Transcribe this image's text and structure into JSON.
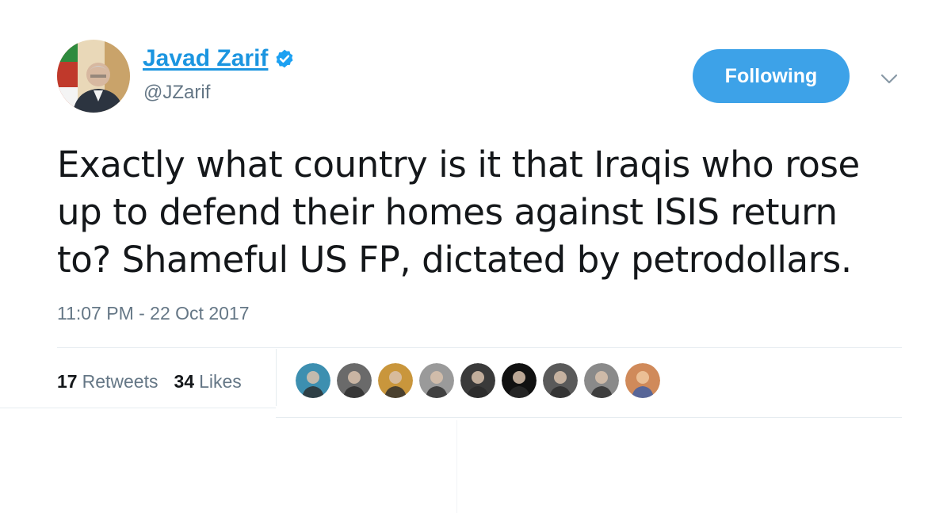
{
  "author": {
    "display_name": "Javad Zarif",
    "handle": "@JZarif",
    "verified": true,
    "avatar_icon": "profile-photo-icon"
  },
  "follow_button": {
    "label": "Following",
    "color": "#3da2e8"
  },
  "menu": {
    "icon": "chevron-down-icon"
  },
  "tweet": {
    "lines": [
      "Exactly what country is it that Iraqis who rose",
      "up to defend their homes against ISIS return",
      "to? Shameful US FP, dictated by petrodollars."
    ],
    "timestamp": "11:07 PM - 22 Oct 2017"
  },
  "stats": {
    "retweets_count": "17",
    "retweets_label": "Retweets",
    "likes_count": "34",
    "likes_label": "Likes"
  },
  "liked_by_avatars": [
    {
      "icon": "liker-avatar-icon",
      "color": "#3d8fb0"
    },
    {
      "icon": "liker-avatar-icon",
      "color": "#6a6a6a"
    },
    {
      "icon": "liker-avatar-icon",
      "color": "#c9963c"
    },
    {
      "icon": "liker-avatar-icon",
      "color": "#9a9a9a"
    },
    {
      "icon": "liker-avatar-icon",
      "color": "#3a3a3a"
    },
    {
      "icon": "liker-avatar-icon",
      "color": "#111111"
    },
    {
      "icon": "liker-avatar-icon",
      "color": "#5a5a5a"
    },
    {
      "icon": "liker-avatar-icon",
      "color": "#8a8a8a"
    },
    {
      "icon": "liker-avatar-icon",
      "color": "#d08a5a"
    }
  ],
  "colors": {
    "link_blue": "#1b95e0",
    "text_primary": "#14171a",
    "text_secondary": "#657786",
    "divider": "#e6ecf0"
  }
}
